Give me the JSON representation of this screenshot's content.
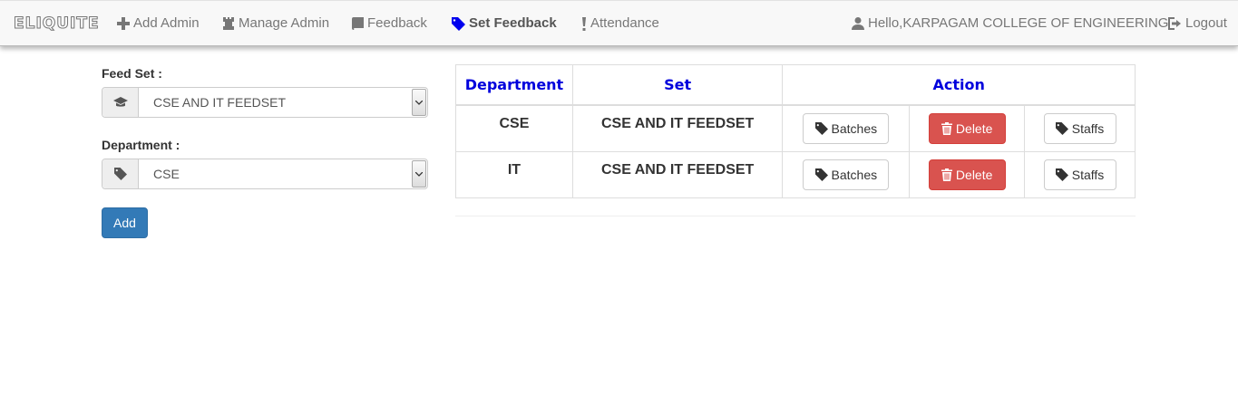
{
  "nav": {
    "brand": "ELIQUITE",
    "items": [
      {
        "label": "Add Admin",
        "icon": "plus-icon"
      },
      {
        "label": "Manage Admin",
        "icon": "tower-icon"
      },
      {
        "label": "Feedback",
        "icon": "book-icon"
      },
      {
        "label": "Set Feedback",
        "icon": "tag-icon",
        "active": true
      },
      {
        "label": "Attendance",
        "icon": "exclamation-icon"
      }
    ],
    "user": "Hello,KARPAGAM COLLEGE OF ENGINEERING",
    "logout": "Logout"
  },
  "form": {
    "feedset_label": "Feed Set :",
    "feedset_value": "CSE AND IT FEEDSET",
    "department_label": "Department :",
    "department_value": "CSE",
    "add_button": "Add"
  },
  "table": {
    "headers": [
      "Department",
      "Set",
      "Action"
    ],
    "rows": [
      {
        "department": "CSE",
        "set": "CSE AND IT FEEDSET",
        "batches": "Batches",
        "delete": "Delete",
        "staffs": "Staffs"
      },
      {
        "department": "IT",
        "set": "CSE AND IT FEEDSET",
        "batches": "Batches",
        "delete": "Delete",
        "staffs": "Staffs"
      }
    ]
  },
  "colors": {
    "primary": "#337ab7",
    "danger": "#d9534f",
    "header_text": "#0000dd"
  }
}
